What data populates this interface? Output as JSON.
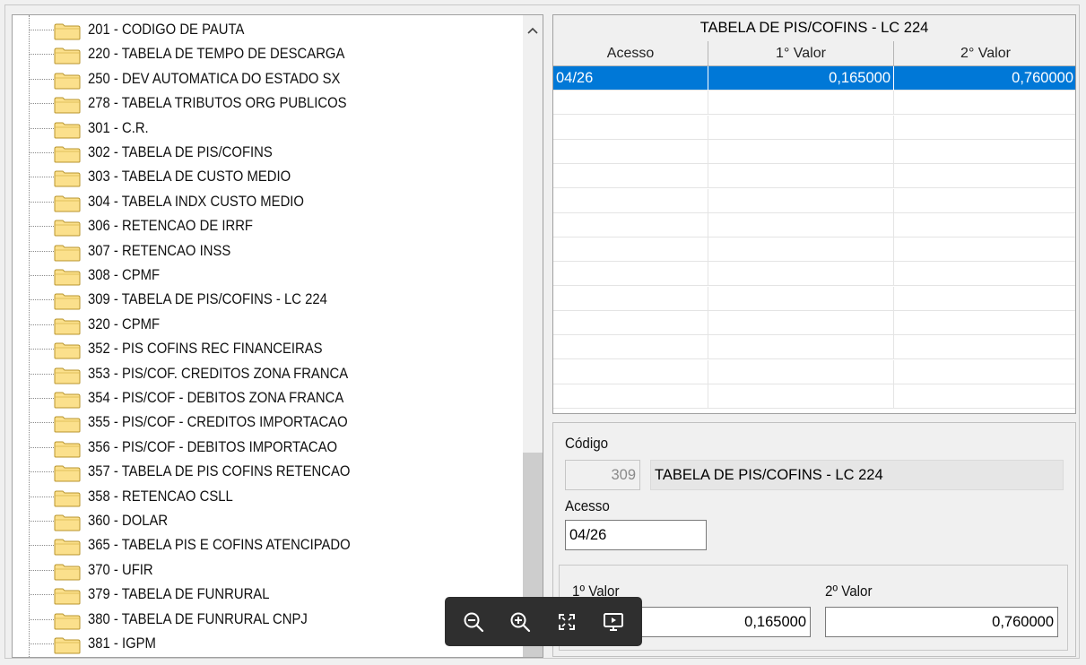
{
  "tree": {
    "items": [
      {
        "label": "201 - CODIGO DE PAUTA"
      },
      {
        "label": "220 - TABELA DE TEMPO DE DESCARGA"
      },
      {
        "label": "250 - DEV AUTOMATICA DO ESTADO SX"
      },
      {
        "label": "278 - TABELA TRIBUTOS ORG PUBLICOS"
      },
      {
        "label": "301 - C.R."
      },
      {
        "label": "302 - TABELA DE PIS/COFINS"
      },
      {
        "label": "303 - TABELA DE CUSTO MEDIO"
      },
      {
        "label": "304 - TABELA INDX CUSTO MEDIO"
      },
      {
        "label": "306 - RETENCAO DE IRRF"
      },
      {
        "label": "307 - RETENCAO INSS"
      },
      {
        "label": "308 - CPMF"
      },
      {
        "label": "309 - TABELA DE PIS/COFINS - LC 224"
      },
      {
        "label": "320 - CPMF"
      },
      {
        "label": "352 - PIS COFINS REC FINANCEIRAS"
      },
      {
        "label": "353 - PIS/COF. CREDITOS ZONA FRANCA"
      },
      {
        "label": "354 - PIS/COF - DEBITOS ZONA FRANCA"
      },
      {
        "label": "355 - PIS/COF - CREDITOS IMPORTACAO"
      },
      {
        "label": "356 - PIS/COF - DEBITOS IMPORTACAO"
      },
      {
        "label": "357 - TABELA DE PIS COFINS RETENCAO"
      },
      {
        "label": "358 - RETENCAO CSLL"
      },
      {
        "label": "360 - DOLAR"
      },
      {
        "label": "365 - TABELA PIS E COFINS ATENCIPADO"
      },
      {
        "label": "370 - UFIR"
      },
      {
        "label": "379 - TABELA DE FUNRURAL"
      },
      {
        "label": "380 - TABELA DE FUNRURAL CNPJ"
      },
      {
        "label": "381 - IGPM"
      }
    ]
  },
  "grid": {
    "title": "TABELA DE PIS/COFINS - LC 224",
    "columns": [
      "Acesso",
      "1° Valor",
      "2° Valor"
    ],
    "rows": [
      {
        "acesso": "04/26",
        "valor1": "0,165000",
        "valor2": "0,760000",
        "selected": true
      }
    ]
  },
  "form": {
    "codigo_label": "Código",
    "codigo_value": "309",
    "descricao_value": "TABELA DE PIS/COFINS - LC 224",
    "acesso_label": "Acesso",
    "acesso_value": "04/26",
    "valor1_label": "1º Valor",
    "valor1_value": "0,165000",
    "valor2_label": "2º Valor",
    "valor2_value": "0,760000"
  },
  "colors": {
    "selection": "#0078d7",
    "folder": "#fbe08c",
    "toolbar": "#2f2f2f"
  },
  "toolbar": {
    "icons": [
      "zoom-out-icon",
      "zoom-in-icon",
      "fit-screen-icon",
      "slideshow-icon"
    ]
  }
}
